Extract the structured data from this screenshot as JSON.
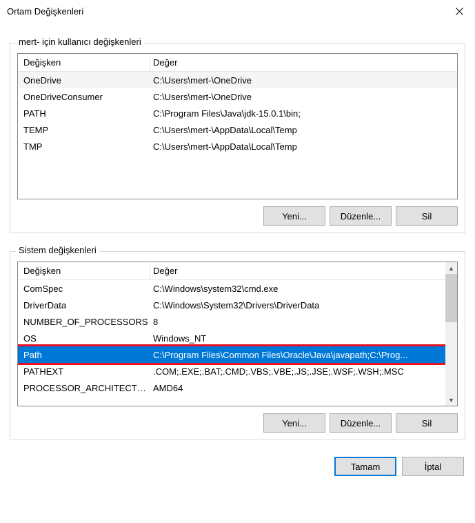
{
  "title": "Ortam Değişkenleri",
  "user_section": {
    "legend": "mert- için kullanıcı değişkenleri",
    "header_var": "Değişken",
    "header_val": "Değer",
    "rows": [
      {
        "var": "OneDrive",
        "val": "C:\\Users\\mert-\\OneDrive"
      },
      {
        "var": "OneDriveConsumer",
        "val": "C:\\Users\\mert-\\OneDrive"
      },
      {
        "var": "PATH",
        "val": "C:\\Program Files\\Java\\jdk-15.0.1\\bin;"
      },
      {
        "var": "TEMP",
        "val": "C:\\Users\\mert-\\AppData\\Local\\Temp"
      },
      {
        "var": "TMP",
        "val": "C:\\Users\\mert-\\AppData\\Local\\Temp"
      }
    ],
    "btn_new": "Yeni...",
    "btn_edit": "Düzenle...",
    "btn_delete": "Sil"
  },
  "system_section": {
    "legend": "Sistem değişkenleri",
    "header_var": "Değişken",
    "header_val": "Değer",
    "rows": [
      {
        "var": "ComSpec",
        "val": "C:\\Windows\\system32\\cmd.exe"
      },
      {
        "var": "DriverData",
        "val": "C:\\Windows\\System32\\Drivers\\DriverData"
      },
      {
        "var": "NUMBER_OF_PROCESSORS",
        "val": "8"
      },
      {
        "var": "OS",
        "val": "Windows_NT"
      },
      {
        "var": "Path",
        "val": "C:\\Program Files\\Common Files\\Oracle\\Java\\javapath;C:\\Prog..."
      },
      {
        "var": "PATHEXT",
        "val": ".COM;.EXE;.BAT;.CMD;.VBS;.VBE;.JS;.JSE;.WSF;.WSH;.MSC"
      },
      {
        "var": "PROCESSOR_ARCHITECTU...",
        "val": "AMD64"
      }
    ],
    "selected_index": 4,
    "btn_new": "Yeni...",
    "btn_edit": "Düzenle...",
    "btn_delete": "Sil"
  },
  "footer": {
    "ok": "Tamam",
    "cancel": "İptal"
  }
}
